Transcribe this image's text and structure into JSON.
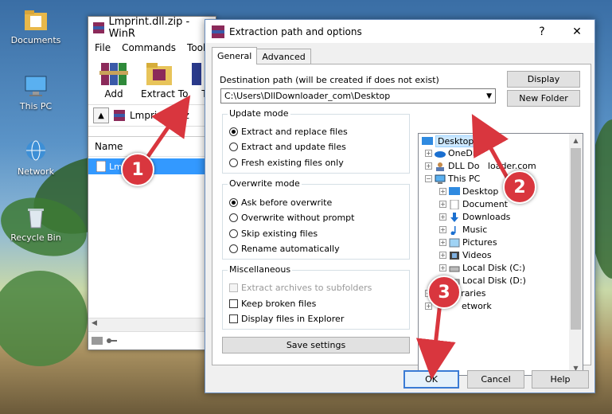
{
  "desktop": {
    "icons": [
      {
        "label": "Documents",
        "icon": "folder-documents-icon"
      },
      {
        "label": "This PC",
        "icon": "computer-icon"
      },
      {
        "label": "Network",
        "icon": "network-icon"
      },
      {
        "label": "Recycle Bin",
        "icon": "recycle-bin-icon"
      }
    ]
  },
  "winrar": {
    "title": "Lmprint.dll.zip - WinR",
    "menu": [
      "File",
      "Commands",
      "Tools"
    ],
    "toolbar": [
      {
        "label": "Add",
        "icon": "books-add-icon"
      },
      {
        "label": "Extract To",
        "icon": "extract-folder-icon"
      },
      {
        "label": "T",
        "icon": "test-icon"
      }
    ],
    "path": "Lmprint.dll.z",
    "column_name": "Name",
    "file_row": "Lmpr     ll"
  },
  "dialog": {
    "title": "Extraction path and options",
    "help_btn": "?",
    "close_btn": "✕",
    "tabs": [
      "General",
      "Advanced"
    ],
    "dest_label": "Destination path (will be created if does not exist)",
    "dest_value": "C:\\Users\\DllDownloader_com\\Desktop",
    "display_btn": "Display",
    "new_folder_btn": "New Folder",
    "update_mode": {
      "title": "Update mode",
      "options": [
        "Extract and replace files",
        "Extract and update files",
        "Fresh existing files only"
      ],
      "selected": 0
    },
    "overwrite_mode": {
      "title": "Overwrite mode",
      "options": [
        "Ask before overwrite",
        "Overwrite without prompt",
        "Skip existing files",
        "Rename automatically"
      ],
      "selected": 0
    },
    "misc": {
      "title": "Miscellaneous",
      "options": [
        "Extract archives to subfolders",
        "Keep broken files",
        "Display files in Explorer"
      ]
    },
    "save_settings_btn": "Save settings",
    "tree": [
      "Desktop",
      "OneDri",
      "DLL Do   loader.com",
      "This PC",
      "Desktop",
      "Document",
      "Downloads",
      "Music",
      "Pictures",
      "Videos",
      "Local Disk (C:)",
      "Local Disk (D:)",
      "Libraries",
      "etwork"
    ],
    "ok_btn": "OK",
    "cancel_btn": "Cancel",
    "help_footer_btn": "Help"
  },
  "callouts": [
    "1",
    "2",
    "3"
  ],
  "colors": {
    "callout": "#d9363e",
    "selection": "#3399ff",
    "tree_selection": "#cce8ff"
  }
}
